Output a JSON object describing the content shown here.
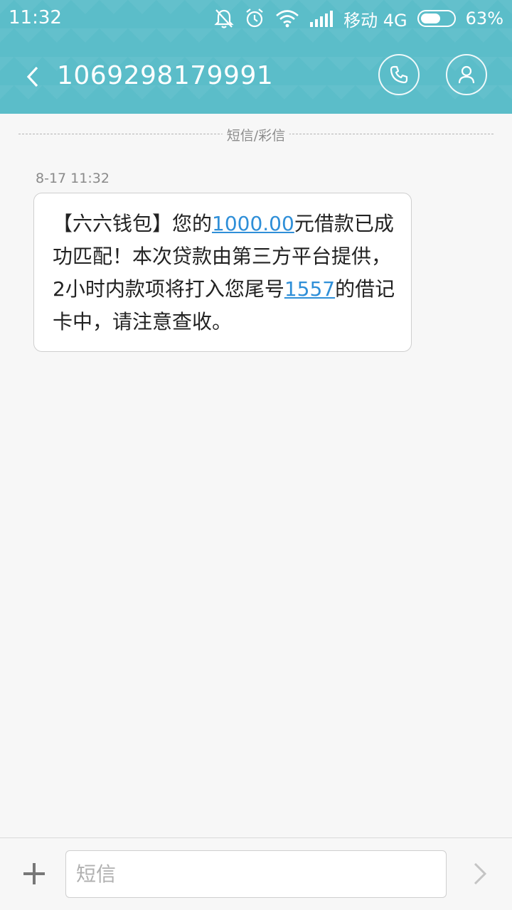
{
  "status_bar": {
    "time": "11:32",
    "carrier": "移动 4G",
    "battery_percent": "63%",
    "battery_level": 0.63,
    "icons": [
      "mute-bell-icon",
      "alarm-icon",
      "wifi-icon",
      "signal-icon",
      "battery-icon"
    ]
  },
  "header": {
    "title": "1069298179991",
    "back_icon": "chevron-left-icon",
    "call_icon": "phone-icon",
    "contact_icon": "person-icon",
    "color": "#5bbdc9"
  },
  "thread": {
    "divider_label": "短信/彩信",
    "messages": [
      {
        "time": "8-17 11:32",
        "parts": [
          {
            "text": "【六六钱包】您的",
            "link": false
          },
          {
            "text": "1000.00",
            "link": true
          },
          {
            "text": "元借款已成功匹配！本次贷款由第三方平台提供，2小时内款项将打入您尾号",
            "link": false
          },
          {
            "text": "1557",
            "link": true
          },
          {
            "text": "的借记卡中，请注意查收。",
            "link": false
          }
        ]
      }
    ]
  },
  "composer": {
    "placeholder": "短信",
    "value": "",
    "plus_icon": "plus-icon",
    "send_icon": "chevron-right-icon"
  },
  "colors": {
    "link": "#2f8fd8",
    "header_bg": "#5bbdc9",
    "page_bg": "#f7f7f7"
  }
}
